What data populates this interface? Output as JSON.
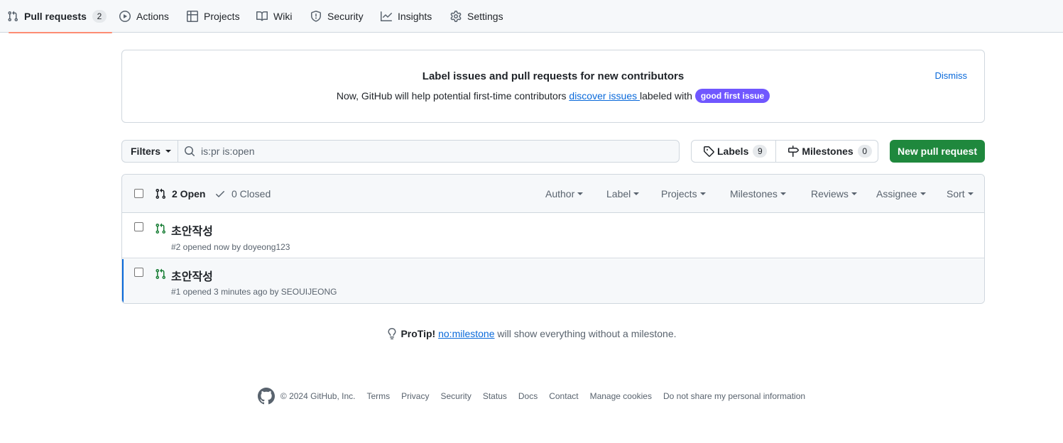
{
  "nav": {
    "tabs": [
      {
        "label": "Pull requests",
        "count": "2",
        "icon": "git-pull-request-icon"
      },
      {
        "label": "Actions",
        "icon": "play-icon"
      },
      {
        "label": "Projects",
        "icon": "table-icon"
      },
      {
        "label": "Wiki",
        "icon": "book-icon"
      },
      {
        "label": "Security",
        "icon": "shield-icon"
      },
      {
        "label": "Insights",
        "icon": "graph-icon"
      },
      {
        "label": "Settings",
        "icon": "gear-icon"
      }
    ],
    "accent_color": "#fd8c73"
  },
  "banner": {
    "title": "Label issues and pull requests for new contributors",
    "text_before": "Now, GitHub will help potential first-time contributors ",
    "link": "discover issues ",
    "text_after": " labeled with ",
    "label_badge": "good first issue",
    "label_color": "#7057ff",
    "dismiss": "Dismiss"
  },
  "filter_bar": {
    "filters_label": "Filters",
    "search_value": "is:pr is:open",
    "labels_label": "Labels",
    "labels_count": "9",
    "milestones_label": "Milestones",
    "milestones_count": "0",
    "new_pr_label": "New pull request",
    "new_pr_color": "#1f883d"
  },
  "list_header": {
    "open_label": "2 Open",
    "closed_label": "0 Closed",
    "sorters": [
      "Author",
      "Label",
      "Projects",
      "Milestones",
      "Reviews",
      "Assignee",
      "Sort"
    ]
  },
  "pull_requests": [
    {
      "title": "초안작성",
      "meta": "#2 opened now by doyeong123"
    },
    {
      "title": "초안작성",
      "meta": "#1 opened 3 minutes ago by SEOUIJEONG"
    }
  ],
  "protip": {
    "label": "ProTip!",
    "link": "no:milestone",
    "text": " will show everything without a milestone."
  },
  "footer": {
    "copyright": "© 2024 GitHub, Inc.",
    "links": [
      "Terms",
      "Privacy",
      "Security",
      "Status",
      "Docs",
      "Contact",
      "Manage cookies",
      "Do not share my personal information"
    ]
  }
}
